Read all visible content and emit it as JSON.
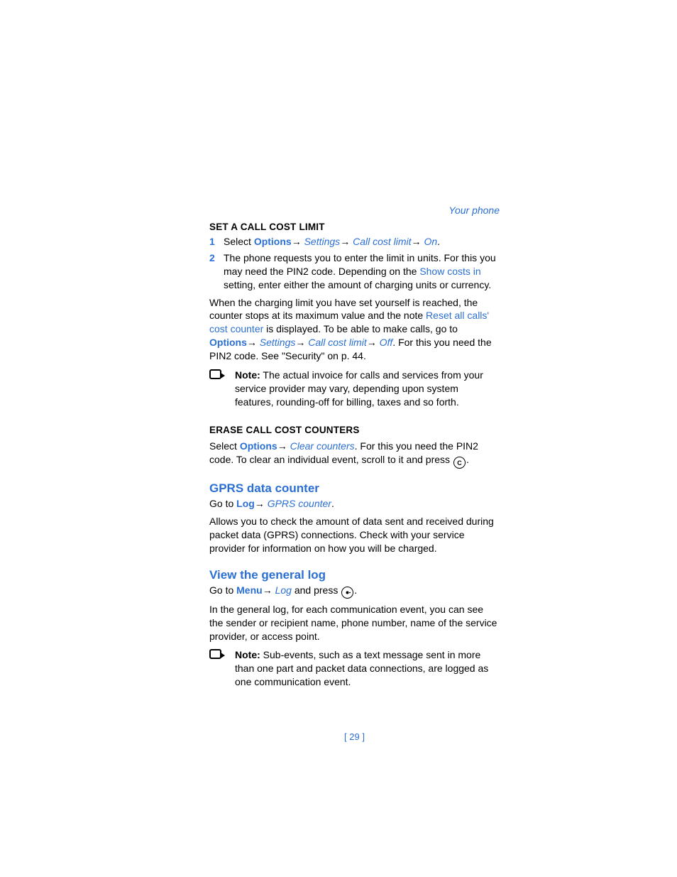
{
  "header": {
    "section": "Your phone"
  },
  "sec1": {
    "title": "SET A CALL COST LIMIT",
    "step1_num": "1",
    "step1_a": "Select ",
    "step1_options": "Options",
    "step1_arrow1": "→ ",
    "step1_settings": "Settings",
    "step1_arrow2": "→ ",
    "step1_ccl": "Call cost limit",
    "step1_arrow3": "→ ",
    "step1_on": "On",
    "step1_dot": ".",
    "step2_num": "2",
    "step2_a": "The phone requests you to enter the limit in units. For this you may need the PIN2 code. Depending on the ",
    "step2_link": "Show costs in",
    "step2_b": " setting, enter either the amount of charging units or currency.",
    "para_a": "When the charging limit you have set yourself is reached, the counter stops at its maximum value and the note ",
    "para_link1": "Reset all calls' cost counter",
    "para_b": " is displayed. To be able to make calls, go to ",
    "para_options": "Options",
    "para_arrow1": "→ ",
    "para_settings": "Settings",
    "para_arrow2": "→ ",
    "para_ccl": "Call cost limit",
    "para_arrow3": "→ ",
    "para_off": "Off",
    "para_c": ". For this you need the PIN2 code. See \"Security\" on p. 44.",
    "note_label": "Note:",
    "note_body": " The actual invoice for calls and services from your service provider may vary, depending upon system features, rounding-off for billing, taxes and so forth."
  },
  "sec2": {
    "title": "ERASE CALL COST COUNTERS",
    "a": "Select ",
    "options": "Options",
    "arrow": "→ ",
    "clear": "Clear counters",
    "b": ". For this you need the PIN2 code. To clear an individual event, scroll to it and press ",
    "key": "C",
    "dot": "."
  },
  "sec3": {
    "title": "GPRS data counter",
    "a": "Go to ",
    "log": "Log",
    "arrow": "→ ",
    "gprs": "GPRS counter",
    "dot": ".",
    "body": "Allows you to check the amount of data sent and received during packet data (GPRS) connections. Check with your service provider for information on how you will be charged."
  },
  "sec4": {
    "title": "View the general log",
    "a": "Go to ",
    "menu": "Menu",
    "arrow": "→ ",
    "log": "Log",
    "b": " and press ",
    "dot": ".",
    "body": "In the general log, for each communication event, you can see the sender or recipient name, phone number, name of the service provider, or access point.",
    "note_label": "Note:",
    "note_body": " Sub-events, such as a text message sent in more than one part and packet data connections, are logged as one communication event."
  },
  "footer": {
    "page": "[ 29 ]"
  }
}
